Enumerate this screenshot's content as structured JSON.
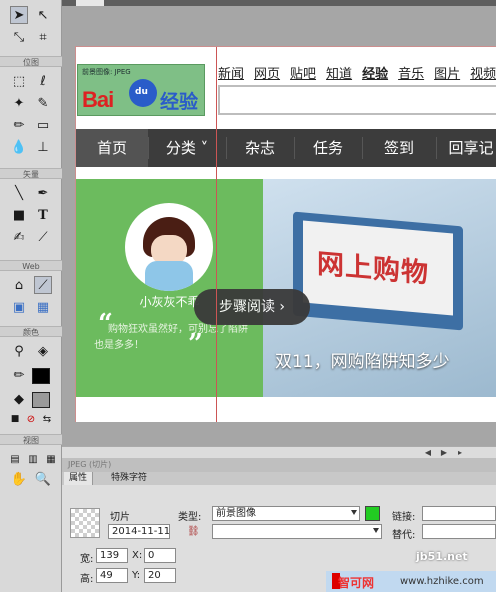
{
  "tools": {
    "sections": {
      "bitmap": "位图",
      "vector": "矢量",
      "web": "Web",
      "colors": "颜色",
      "view": "视图"
    },
    "icons": [
      "pointer-icon",
      "subselect-icon",
      "scale-icon",
      "crop-icon",
      "marquee-icon",
      "lasso-icon",
      "magic-wand-icon",
      "brush-icon",
      "pencil-icon",
      "eraser-icon",
      "blur-icon",
      "rubber-stamp-icon",
      "line-icon",
      "pen-icon",
      "rectangle-icon",
      "text-icon",
      "freeform-icon",
      "knife-icon",
      "hotspot-icon",
      "slice-icon",
      "hide-slices-icon",
      "show-slices-icon",
      "eyedropper-icon",
      "paint-bucket-icon",
      "stroke-color-icon",
      "fill-color-icon",
      "default-colors-icon",
      "no-color-icon",
      "swap-colors-icon",
      "standard-screen-icon",
      "full-screen-menus-icon",
      "full-screen-icon",
      "hand-icon",
      "zoom-icon"
    ],
    "stroke_color": "#000000",
    "fill_color": "#ffffff"
  },
  "canvas": {
    "slice_label": "前景图像: JPEG",
    "logo": {
      "bai": "Bai",
      "du": "du",
      "jingyan": "经验"
    },
    "top_links": [
      "新闻",
      "网页",
      "贴吧",
      "知道",
      "经验",
      "音乐",
      "图片",
      "视频"
    ],
    "nav": [
      "首页",
      "分类 ˅",
      "杂志",
      "任务",
      "签到",
      "回享记"
    ],
    "user_name": "小灰灰不乖",
    "quote": "购物狂欢虽然好，可别忘了陷阱也是多多！",
    "monitor_text": "网上购物",
    "caption": "双11，网购陷阱知多少",
    "step_button": "步骤阅读 ›"
  },
  "status_text": "JPEG (切片)",
  "properties": {
    "tabs": [
      "属性",
      "特殊字符"
    ],
    "object_type": "切片",
    "object_name": "2014-11-11_",
    "type_label": "类型:",
    "type_value": "前景图像",
    "link_label": "链接:",
    "alt_label": "替代:",
    "slice_color": "#22cc22",
    "w_label": "宽:",
    "w_value": "139",
    "h_label": "高:",
    "h_value": "49",
    "x_label": "X:",
    "x_value": "0",
    "y_label": "Y:",
    "y_value": "20"
  },
  "watermarks": {
    "site_a": "jb51.net",
    "site_b_logo": "智可网",
    "site_b_url": "www.hzhike.com"
  }
}
